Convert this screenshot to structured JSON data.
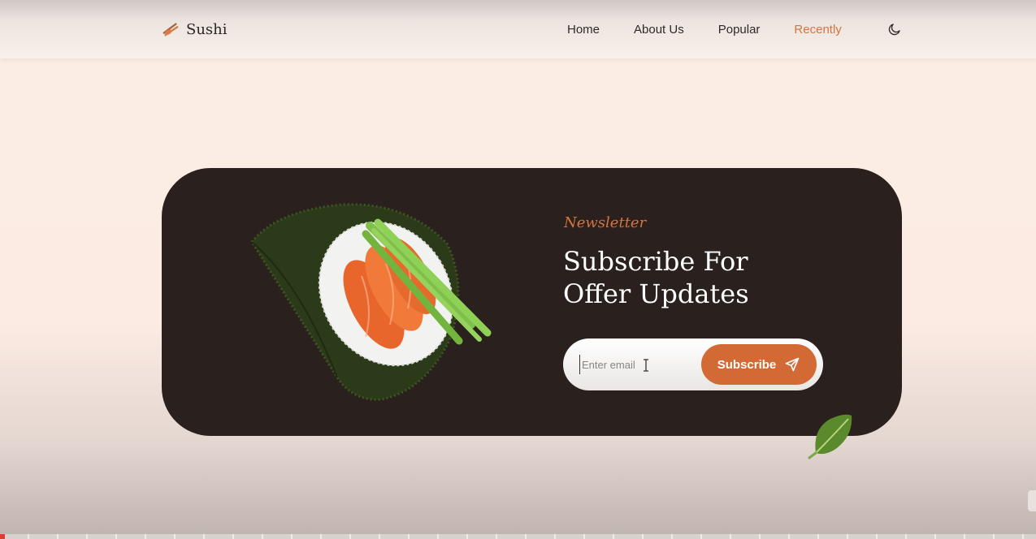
{
  "header": {
    "brand": "Sushi",
    "nav": [
      {
        "label": "Home",
        "active": false
      },
      {
        "label": "About Us",
        "active": false
      },
      {
        "label": "Popular",
        "active": false
      },
      {
        "label": "Recently",
        "active": true
      }
    ],
    "theme_icon": "moon-icon"
  },
  "newsletter": {
    "kicker": "Newsletter",
    "title_line1": "Subscribe For",
    "title_line2": "Offer Updates",
    "email_placeholder": "Enter email",
    "button_label": "Subscribe",
    "button_icon": "send-icon",
    "image": "sushi-hand-roll",
    "decoration": "leaf-icon"
  },
  "colors": {
    "accent": "#d8733e",
    "card_bg": "#2a201d",
    "page_bg": "#fbebe3",
    "button_bg": "#d36a35"
  }
}
